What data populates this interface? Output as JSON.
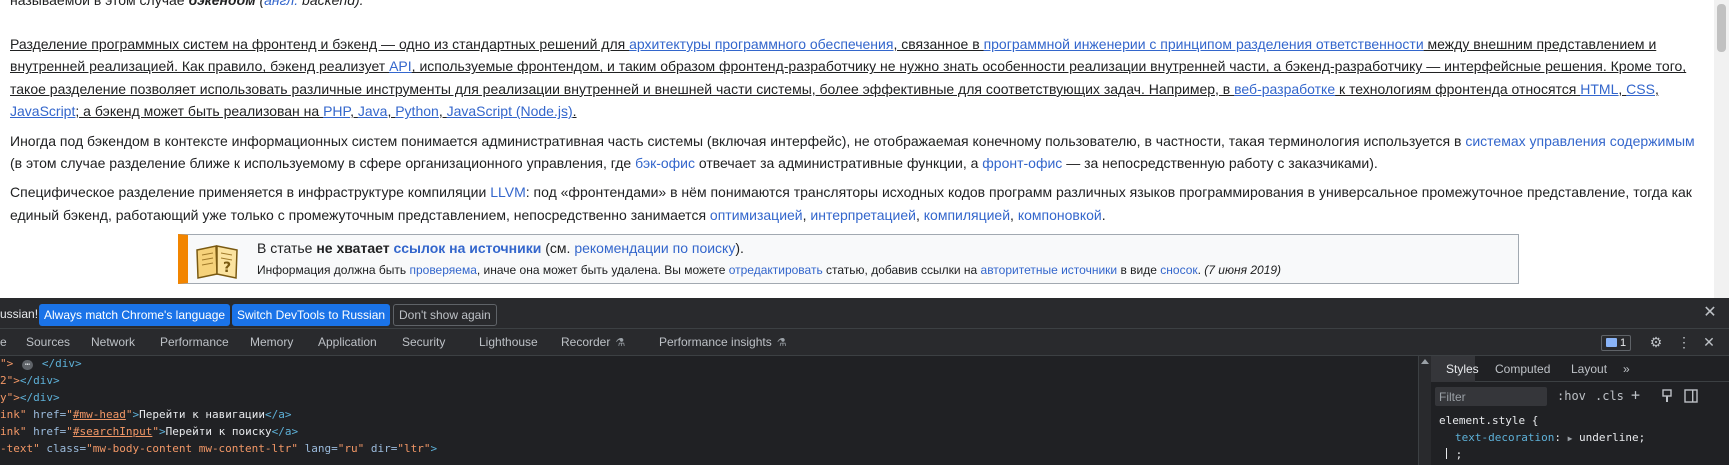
{
  "page": {
    "top_fragment": {
      "prefix": "называемой в этом случае ",
      "bold": "бэкендом",
      "lang_paren_open": " (",
      "lang_link": "англ.",
      "lang_word": " backend",
      "lang_paren_close": ")."
    },
    "para1": {
      "t1": "Разделение программных систем на фронтенд и бэкенд — одно из стандартных решений для ",
      "l1": "архитектуры программного обеспечения",
      "t2": ", связанное в ",
      "l2": "программной инженерии с принципом разделения ответственности",
      "t3": " между внешним представлением и внутренней реализацией. Как правило, бэкенд реализует ",
      "l3": "API",
      "t4": ", используемые фронтендом, и таким образом фронтенд-разработчику не нужно знать особенности реализации внутренней части, а бэкенд-разработчику — интерфейсные решения. Кроме того, такое разделение позволяет использовать различные инструменты для реализации внутренней и внешней части системы, более эффективные для соответствующих задач. Например, в ",
      "l4": "веб-разработке",
      "t5": " к технологиям фронтенда относятся ",
      "l5": "HTML",
      "t6": ", ",
      "l6": "CSS",
      "t7": ", ",
      "l7": "JavaScript",
      "t8": "; а бэкенд может быть реализован на ",
      "l8": "PHP",
      "t9": ", ",
      "l9": "Java",
      "t10": ", ",
      "l10": "Python",
      "t11": ", ",
      "l11": "JavaScript (Node.js)",
      "t12": "."
    },
    "para2": {
      "t1": "Иногда под бэкендом в контексте информационных систем понимается административная часть системы (включая интерфейс), не отображаемая конечному пользователю, в частности, такая терминология используется в ",
      "l1": "системах управления содержимым",
      "t2": " (в этом случае разделение ближе к используемому в сфере организационного управления, где ",
      "l2": "бэк-офис",
      "t3": " отвечает за административные функции, а ",
      "l3": "фронт-офис",
      "t4": " — за непосредственную работу с заказчиками)."
    },
    "para3": {
      "t1": "Специфическое разделение применяется в инфраструктуре компиляции ",
      "l1": "LLVM",
      "t2": ": под «фронтендами» в нём понимаются трансляторы исходных кодов программ различных языков программирования в универсальное промежуточное представление, тогда как единый бэкенд, работающий уже только с промежуточным представлением, непосредственно занимается ",
      "l2": "оптимизацией",
      "t3": ", ",
      "l3": "интерпретацией",
      "t4": ", ",
      "l4": "компиляцией",
      "t5": ", ",
      "l5": "компоновкой",
      "t6": "."
    },
    "ambox": {
      "l1_t1": "В статье ",
      "l1_bold": "не хватает ",
      "l1_bold_link": "ссылок на источники",
      "l1_t2": " (см. ",
      "l1_link": "рекомендации по поиску",
      "l1_t3": ").",
      "l2_t1": "Информация должна быть ",
      "l2_link1": "проверяема",
      "l2_t2": ", иначе она может быть удалена. Вы можете ",
      "l2_link2": "отредактировать",
      "l2_t3": " статью, добавив ссылки на ",
      "l2_link3": "авторитетные источники",
      "l2_t4": " в виде ",
      "l2_link4": "сносок",
      "l2_t5": ". ",
      "l2_date": "(7 июня 2019)"
    }
  },
  "devtools": {
    "lang_bar": {
      "message": "ussian!",
      "always_match": "Always match Chrome's language",
      "switch": "Switch DevTools to Russian",
      "dont_show": "Don't show again",
      "close": "✕"
    },
    "tabs": [
      {
        "label": "e"
      },
      {
        "label": "Sources"
      },
      {
        "label": "Network"
      },
      {
        "label": "Performance"
      },
      {
        "label": "Memory"
      },
      {
        "label": "Application"
      },
      {
        "label": "Security"
      },
      {
        "label": "Lighthouse"
      },
      {
        "label": "Recorder"
      },
      {
        "label": "Performance insights"
      }
    ],
    "flask": "⚗",
    "issues_count": "1",
    "icons": {
      "settings": "⚙",
      "more": "⋮",
      "close": "✕"
    },
    "elements": {
      "line1": {
        "pre": "\">",
        "ellipsis": "⋯",
        "tag": "</div>"
      },
      "line2": {
        "pre": "2\">",
        "tag": "</div>"
      },
      "line3": {
        "pre": "y\">",
        "tag": "</div>"
      },
      "line4": {
        "name": "ink\"",
        "attr": " href=",
        "q1": "\"",
        "val": "#mw-head",
        "q2": "\"",
        "close": ">",
        "text": "Перейти к навигации",
        "end": "</a>"
      },
      "line5": {
        "name": "ink\"",
        "attr": " href=",
        "q1": "\"",
        "val": "#searchInput",
        "q2": "\"",
        "close": ">",
        "text": "Перейти к поиску",
        "end": "</a>"
      },
      "line6": {
        "pre": "-text\"",
        "a1": " class=",
        "v1": "\"mw-body-content mw-content-ltr\"",
        "a2": " lang=",
        "v2": "\"ru\"",
        "a3": " dir=",
        "v3": "\"ltr\"",
        "close": ">"
      }
    },
    "styles": {
      "tabs": {
        "styles": "Styles",
        "computed": "Computed",
        "layout": "Layout",
        "more": "»"
      },
      "filter_placeholder": "Filter",
      "hov": ":hov",
      "cls": ".cls",
      "plus": "+",
      "selector": "element.style {",
      "prop": "text-decoration",
      "colon": ": ",
      "tri": "▶",
      "value": " underline;",
      "semicolon": " ;"
    }
  }
}
